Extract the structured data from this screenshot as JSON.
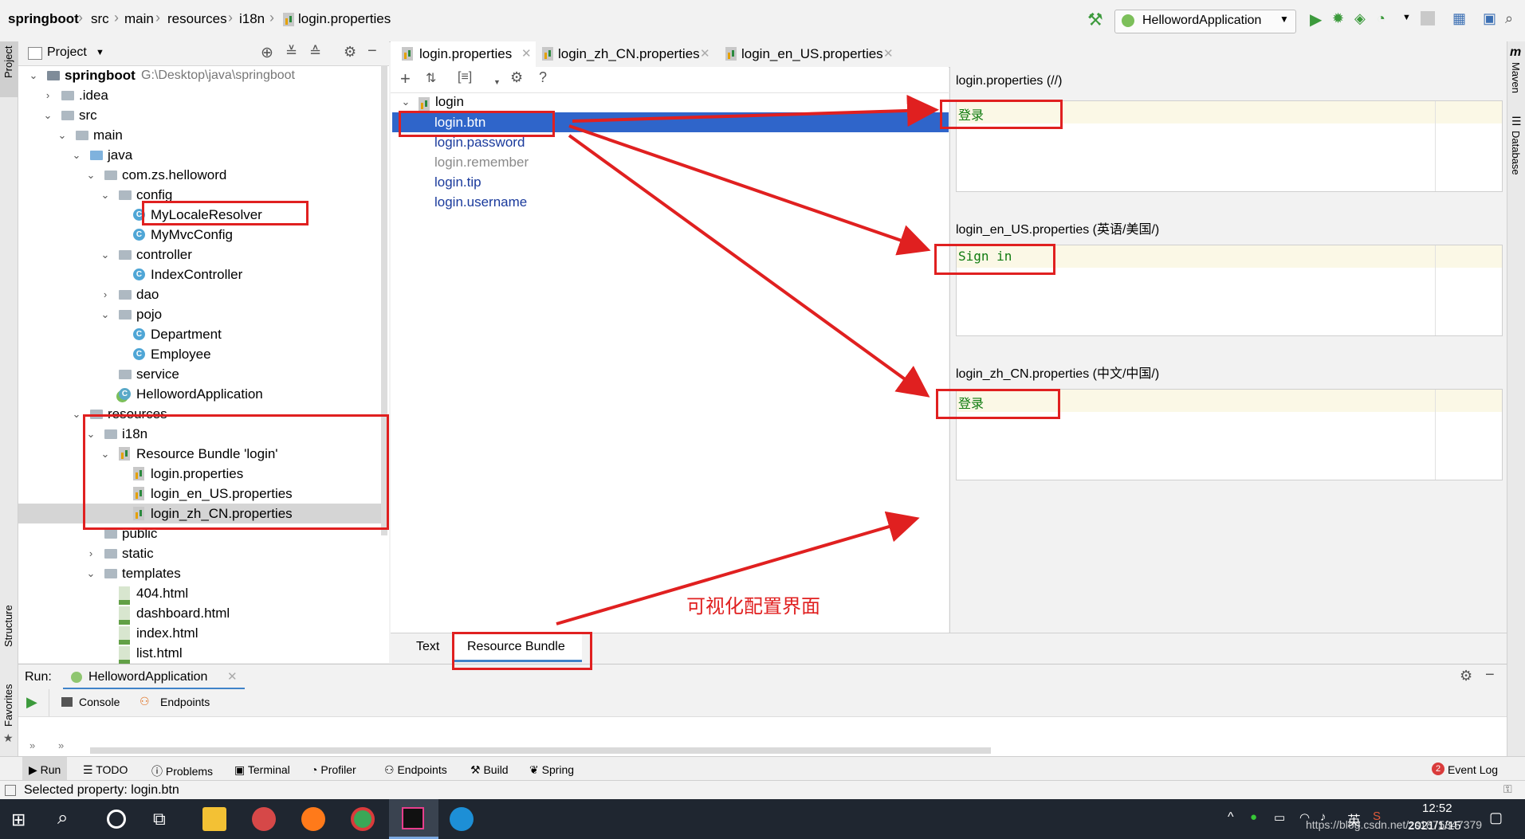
{
  "breadcrumb": [
    "springboot",
    "src",
    "main",
    "resources",
    "i18n",
    "login.properties"
  ],
  "run_config": "HellowordApplication",
  "left_stripe": {
    "project": "Project",
    "structure": "Structure",
    "favorites": "Favorites"
  },
  "right_stripe": {
    "maven": "Maven",
    "database": "Database"
  },
  "project": {
    "title": "Project",
    "tree": [
      {
        "label": "springboot",
        "extra": "G:\\Desktop\\java\\springboot",
        "depth": 0,
        "exp": "open",
        "icon": "module"
      },
      {
        "label": ".idea",
        "depth": 1,
        "exp": "closed",
        "icon": "folder"
      },
      {
        "label": "src",
        "depth": 1,
        "exp": "open",
        "icon": "folder"
      },
      {
        "label": "main",
        "depth": 2,
        "exp": "open",
        "icon": "folder"
      },
      {
        "label": "java",
        "depth": 3,
        "exp": "open",
        "icon": "folder-blue"
      },
      {
        "label": "com.zs.helloword",
        "depth": 4,
        "exp": "open",
        "icon": "package"
      },
      {
        "label": "config",
        "depth": 5,
        "exp": "open",
        "icon": "package"
      },
      {
        "label": "MyLocaleResolver",
        "depth": 6,
        "exp": "none",
        "icon": "class"
      },
      {
        "label": "MyMvcConfig",
        "depth": 6,
        "exp": "none",
        "icon": "class"
      },
      {
        "label": "controller",
        "depth": 5,
        "exp": "open",
        "icon": "package"
      },
      {
        "label": "IndexController",
        "depth": 6,
        "exp": "none",
        "icon": "class"
      },
      {
        "label": "dao",
        "depth": 5,
        "exp": "closed",
        "icon": "package"
      },
      {
        "label": "pojo",
        "depth": 5,
        "exp": "open",
        "icon": "package"
      },
      {
        "label": "Department",
        "depth": 6,
        "exp": "none",
        "icon": "class"
      },
      {
        "label": "Employee",
        "depth": 6,
        "exp": "none",
        "icon": "class"
      },
      {
        "label": "service",
        "depth": 5,
        "exp": "none",
        "icon": "package"
      },
      {
        "label": "HellowordApplication",
        "depth": 5,
        "exp": "none",
        "icon": "springclass"
      },
      {
        "label": "resources",
        "depth": 3,
        "exp": "open",
        "icon": "folder"
      },
      {
        "label": "i18n",
        "depth": 4,
        "exp": "open",
        "icon": "folder"
      },
      {
        "label": "Resource Bundle 'login'",
        "depth": 5,
        "exp": "open",
        "icon": "bundle"
      },
      {
        "label": "login.properties",
        "depth": 6,
        "exp": "none",
        "icon": "props"
      },
      {
        "label": "login_en_US.properties",
        "depth": 6,
        "exp": "none",
        "icon": "props"
      },
      {
        "label": "login_zh_CN.properties",
        "depth": 6,
        "exp": "none",
        "icon": "props",
        "selected": true
      },
      {
        "label": "public",
        "depth": 4,
        "exp": "none",
        "icon": "folder"
      },
      {
        "label": "static",
        "depth": 4,
        "exp": "closed",
        "icon": "folder"
      },
      {
        "label": "templates",
        "depth": 4,
        "exp": "open",
        "icon": "folder"
      },
      {
        "label": "404.html",
        "depth": 5,
        "exp": "none",
        "icon": "html"
      },
      {
        "label": "dashboard.html",
        "depth": 5,
        "exp": "none",
        "icon": "html"
      },
      {
        "label": "index.html",
        "depth": 5,
        "exp": "none",
        "icon": "html"
      },
      {
        "label": "list.html",
        "depth": 5,
        "exp": "none",
        "icon": "html"
      }
    ]
  },
  "editor_tabs": [
    {
      "label": "login.properties",
      "active": true
    },
    {
      "label": "login_zh_CN.properties",
      "active": false
    },
    {
      "label": "login_en_US.properties",
      "active": false
    }
  ],
  "bundle": {
    "root": "login",
    "keys": [
      {
        "label": "login.btn",
        "selected": true
      },
      {
        "label": "login.password"
      },
      {
        "label": "login.remember",
        "muted": true
      },
      {
        "label": "login.tip"
      },
      {
        "label": "login.username"
      }
    ],
    "values": [
      {
        "label": "login.properties (//)",
        "value": "登录"
      },
      {
        "label": "login_en_US.properties (英语/美国/)",
        "value": "Sign in"
      },
      {
        "label": "login_zh_CN.properties (中文/中国/)",
        "value": "登录"
      }
    ],
    "tab_text": "Text",
    "tab_bundle": "Resource Bundle"
  },
  "annotation_text": "可视化配置界面",
  "run": {
    "label": "Run:",
    "config": "HellowordApplication",
    "console": "Console",
    "endpoints": "Endpoints"
  },
  "tool_strip": [
    "Run",
    "TODO",
    "Problems",
    "Terminal",
    "Profiler",
    "Endpoints",
    "Build",
    "Spring"
  ],
  "event_log": "Event Log",
  "event_count": "2",
  "status": "Selected property: login.btn",
  "taskbar": {
    "time": "12:52",
    "date": "2021/1/15",
    "lang": "英",
    "watermark": "https://blog.csdn.net/zs1875347379"
  },
  "colors": {
    "annotation": "#e02020",
    "selection": "#2f65ca",
    "key_text": "#1a3a9c",
    "value_text": "#0f7b0f"
  }
}
